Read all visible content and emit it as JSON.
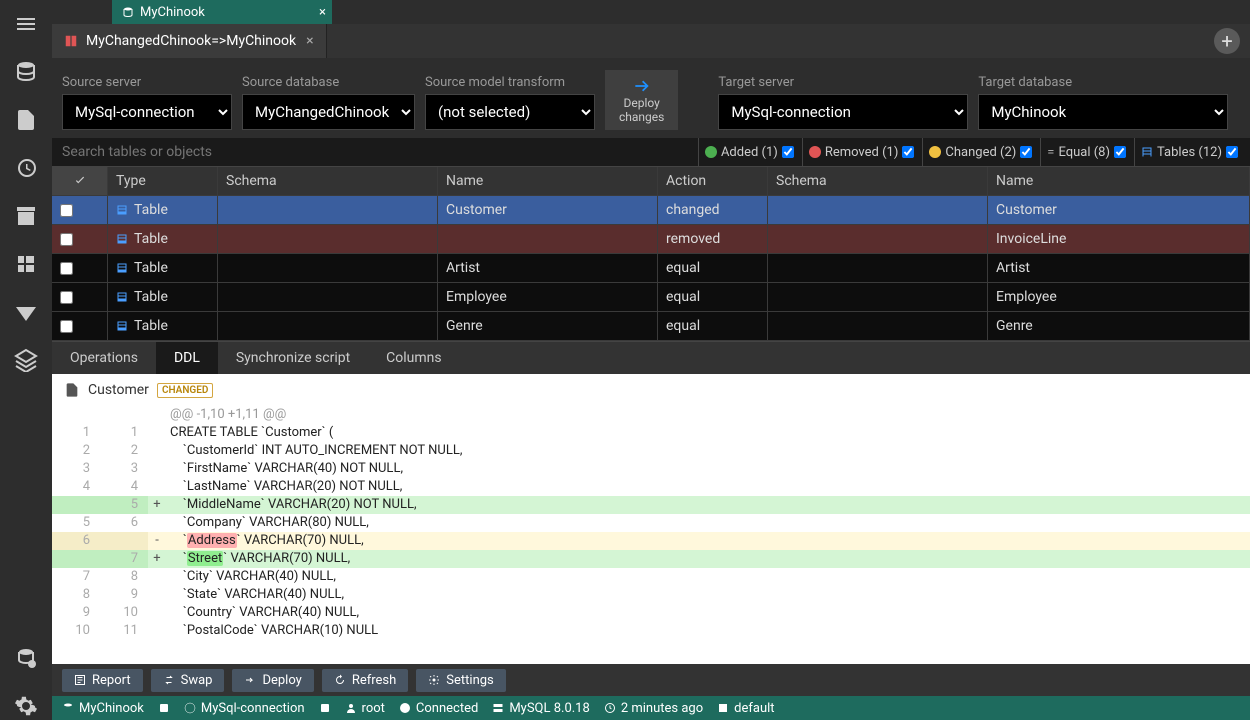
{
  "pinned_tab": {
    "label": "MyChinook"
  },
  "content_tab": {
    "label": "MyChangedChinook=>MyChinook"
  },
  "toolbar": {
    "source_server_label": "Source server",
    "source_db_label": "Source database",
    "source_transform_label": "Source model transform",
    "target_server_label": "Target server",
    "target_db_label": "Target database",
    "source_server": "MySql-connection",
    "source_db": "MyChangedChinook",
    "source_transform": "(not selected)",
    "target_server": "MySql-connection",
    "target_db": "MyChinook",
    "deploy_l1": "Deploy",
    "deploy_l2": "changes"
  },
  "filters": {
    "search_placeholder": "Search tables or objects",
    "added": "Added (1)",
    "removed": "Removed (1)",
    "changed": "Changed (2)",
    "equal": "Equal (8)",
    "tables": "Tables (12)"
  },
  "headers": {
    "type": "Type",
    "schema": "Schema",
    "name": "Name",
    "action": "Action",
    "schema2": "Schema",
    "name2": "Name"
  },
  "rows": [
    {
      "type": "Table",
      "schema": "",
      "name": "Customer",
      "action": "changed",
      "schema2": "",
      "name2": "Customer",
      "state": "changed",
      "sel": true
    },
    {
      "type": "Table",
      "schema": "",
      "name": "",
      "action": "removed",
      "schema2": "",
      "name2": "InvoiceLine",
      "state": "removed"
    },
    {
      "type": "Table",
      "schema": "",
      "name": "Artist",
      "action": "equal",
      "schema2": "",
      "name2": "Artist",
      "state": "equal"
    },
    {
      "type": "Table",
      "schema": "",
      "name": "Employee",
      "action": "equal",
      "schema2": "",
      "name2": "Employee",
      "state": "equal"
    },
    {
      "type": "Table",
      "schema": "",
      "name": "Genre",
      "action": "equal",
      "schema2": "",
      "name2": "Genre",
      "state": "equal"
    }
  ],
  "detail_tabs": {
    "ops": "Operations",
    "ddl": "DDL",
    "sync": "Synchronize script",
    "cols": "Columns"
  },
  "diff_header": {
    "title": "Customer",
    "badge": "CHANGED"
  },
  "diff_lines": [
    {
      "l": "",
      "r": "",
      "t": "hunk",
      "m": "",
      "c": "@@ -1,10 +1,11 @@"
    },
    {
      "l": "1",
      "r": "1",
      "t": "ctx",
      "m": "",
      "c": "CREATE TABLE `Customer` ("
    },
    {
      "l": "2",
      "r": "2",
      "t": "ctx",
      "m": "",
      "c": "    `CustomerId` INT AUTO_INCREMENT NOT NULL,"
    },
    {
      "l": "3",
      "r": "3",
      "t": "ctx",
      "m": "",
      "c": "    `FirstName` VARCHAR(40) NOT NULL,"
    },
    {
      "l": "4",
      "r": "4",
      "t": "ctx",
      "m": "",
      "c": "    `LastName` VARCHAR(20) NOT NULL,"
    },
    {
      "l": "",
      "r": "5",
      "t": "add",
      "m": "+",
      "c": "    `MiddleName` VARCHAR(20) NOT NULL,"
    },
    {
      "l": "5",
      "r": "6",
      "t": "ctx",
      "m": "",
      "c": "    `Company` VARCHAR(80) NULL,"
    },
    {
      "l": "6",
      "r": "",
      "t": "del",
      "m": "-",
      "c": "    `",
      "hl": "Address",
      "c2": "` VARCHAR(70) NULL,"
    },
    {
      "l": "",
      "r": "7",
      "t": "add",
      "m": "+",
      "c": "    `",
      "hl": "Street",
      "c2": "` VARCHAR(70) NULL,"
    },
    {
      "l": "7",
      "r": "8",
      "t": "ctx",
      "m": "",
      "c": "    `City` VARCHAR(40) NULL,"
    },
    {
      "l": "8",
      "r": "9",
      "t": "ctx",
      "m": "",
      "c": "    `State` VARCHAR(40) NULL,"
    },
    {
      "l": "9",
      "r": "10",
      "t": "ctx",
      "m": "",
      "c": "    `Country` VARCHAR(40) NULL,"
    },
    {
      "l": "10",
      "r": "11",
      "t": "ctx",
      "m": "",
      "c": "    `PostalCode` VARCHAR(10) NULL"
    }
  ],
  "actions": {
    "report": "Report",
    "swap": "Swap",
    "deploy": "Deploy",
    "refresh": "Refresh",
    "settings": "Settings"
  },
  "status": {
    "db": "MyChinook",
    "conn": "MySql-connection",
    "user": "root",
    "state": "Connected",
    "server": "MySQL 8.0.18",
    "time": "2 minutes ago",
    "default": "default"
  }
}
